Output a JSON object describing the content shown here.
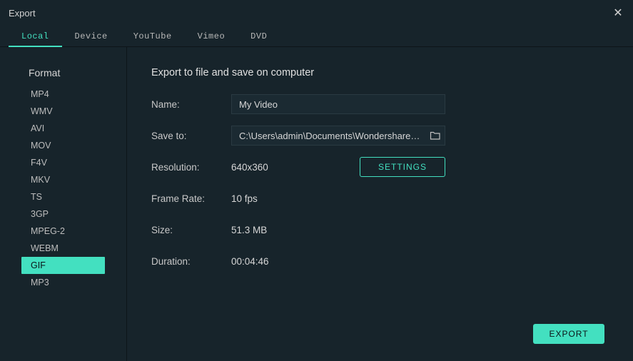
{
  "window": {
    "title": "Export"
  },
  "tabs": [
    "Local",
    "Device",
    "YouTube",
    "Vimeo",
    "DVD"
  ],
  "active_tab_index": 0,
  "sidebar": {
    "heading": "Format",
    "items": [
      "MP4",
      "WMV",
      "AVI",
      "MOV",
      "F4V",
      "MKV",
      "TS",
      "3GP",
      "MPEG-2",
      "WEBM",
      "GIF",
      "MP3"
    ],
    "selected_index": 10
  },
  "main": {
    "heading": "Export to file and save on computer",
    "name_label": "Name:",
    "name_value": "My Video",
    "saveto_label": "Save to:",
    "saveto_value": "C:\\Users\\admin\\Documents\\Wondershare Fil",
    "resolution_label": "Resolution:",
    "resolution_value": "640x360",
    "settings_button": "SETTINGS",
    "framerate_label": "Frame Rate:",
    "framerate_value": "10 fps",
    "size_label": "Size:",
    "size_value": "51.3 MB",
    "duration_label": "Duration:",
    "duration_value": "00:04:46",
    "export_button": "EXPORT"
  },
  "colors": {
    "accent": "#43e0c0",
    "bg": "#17242b"
  }
}
